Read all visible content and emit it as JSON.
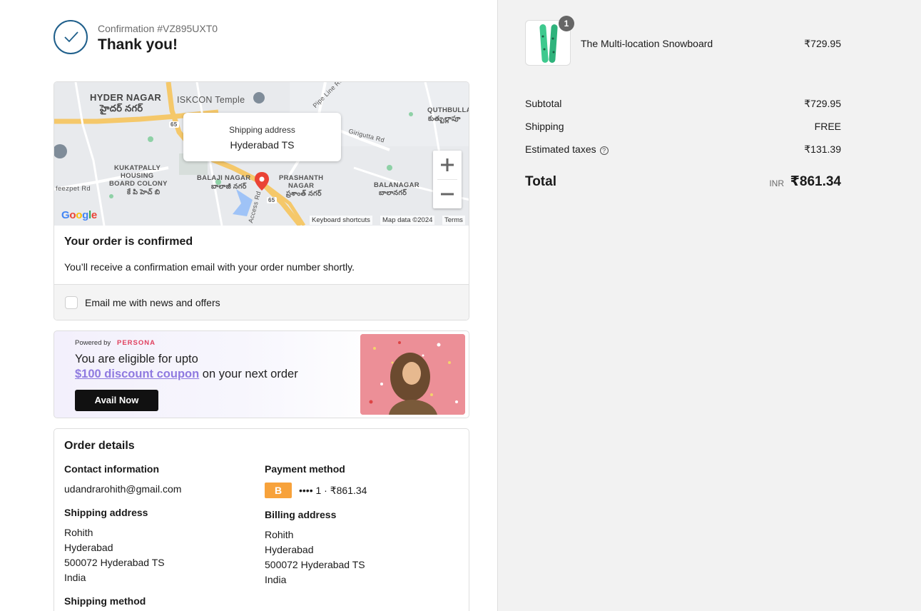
{
  "header": {
    "confirmation": "Confirmation #VZ895UXT0",
    "thank_you": "Thank you!"
  },
  "map": {
    "tooltip_title": "Shipping address",
    "tooltip_value": "Hyderabad TS",
    "labels": {
      "hyder_nagar": "HYDER NAGAR",
      "hyder_nagar_te": "హైదర్ నగర్",
      "iskcon": "ISKCON Temple",
      "pipe_line": "Pipe Line Rd",
      "quthbullapur": "QUTHBULLA",
      "quthbullapur_te": "కుత్బుల్లాపూ",
      "kukatpally1": "KUKATPALLY",
      "kukatpally2": "HOUSING",
      "kukatpally3": "BOARD COLONY",
      "kukatpally_te": "కే పి హెచ్ బి",
      "balaji": "BALAJI NAGAR",
      "balaji_te": "బాలాజీ నగర్",
      "prashanth1": "PRASHANTH",
      "prashanth2": "NAGAR",
      "prashanth_te": "ప్రశాంత్ నగర్",
      "balanagar": "BALANAGAR",
      "balanagar_te": "బాలానగర్",
      "girigutta": "Girigutta Rd",
      "feezpet": "feezpet Rd",
      "access": "Access Rd",
      "hw65": "65"
    },
    "footer_shortcuts": "Keyboard shortcuts",
    "footer_data": "Map data ©2024",
    "footer_terms": "Terms",
    "google": "Google"
  },
  "confirmation_card": {
    "title": "Your order is confirmed",
    "text": "You’ll receive a confirmation email with your order number shortly.",
    "newsletter_label": "Email me with news and offers",
    "newsletter_checked": false
  },
  "banner": {
    "powered_by": "Powered by",
    "brand": "PERSONA",
    "line1": "You are eligible for upto",
    "coupon": "$100 discount coupon",
    "line2_rest": " on your next order",
    "button": "Avail Now"
  },
  "order_details": {
    "title": "Order details",
    "contact_heading": "Contact information",
    "email": "udandrarohith@gmail.com",
    "payment_heading": "Payment method",
    "payment_icon": "B",
    "payment_text": "•••• 1 · ₹861.34",
    "shipping_heading": "Shipping address",
    "shipping_lines": [
      "Rohith",
      "Hyderabad",
      "500072 Hyderabad TS",
      "India"
    ],
    "billing_heading": "Billing address",
    "billing_lines": [
      "Rohith",
      "Hyderabad",
      "500072 Hyderabad TS",
      "India"
    ],
    "shipping_method_heading": "Shipping method"
  },
  "summary": {
    "product": {
      "name": "The Multi-location Snowboard",
      "price": "₹729.95",
      "quantity": "1"
    },
    "subtotal_label": "Subtotal",
    "subtotal": "₹729.95",
    "shipping_label": "Shipping",
    "shipping": "FREE",
    "taxes_label": "Estimated taxes",
    "taxes": "₹131.39",
    "total_label": "Total",
    "currency": "INR",
    "total": "₹861.34"
  },
  "colors": {
    "accent": "#1f5f8b",
    "summary_bg": "#f2f2f2",
    "coupon": "#8f7ae0",
    "persona": "#e0415e",
    "payment_badge": "#f7a23b"
  }
}
